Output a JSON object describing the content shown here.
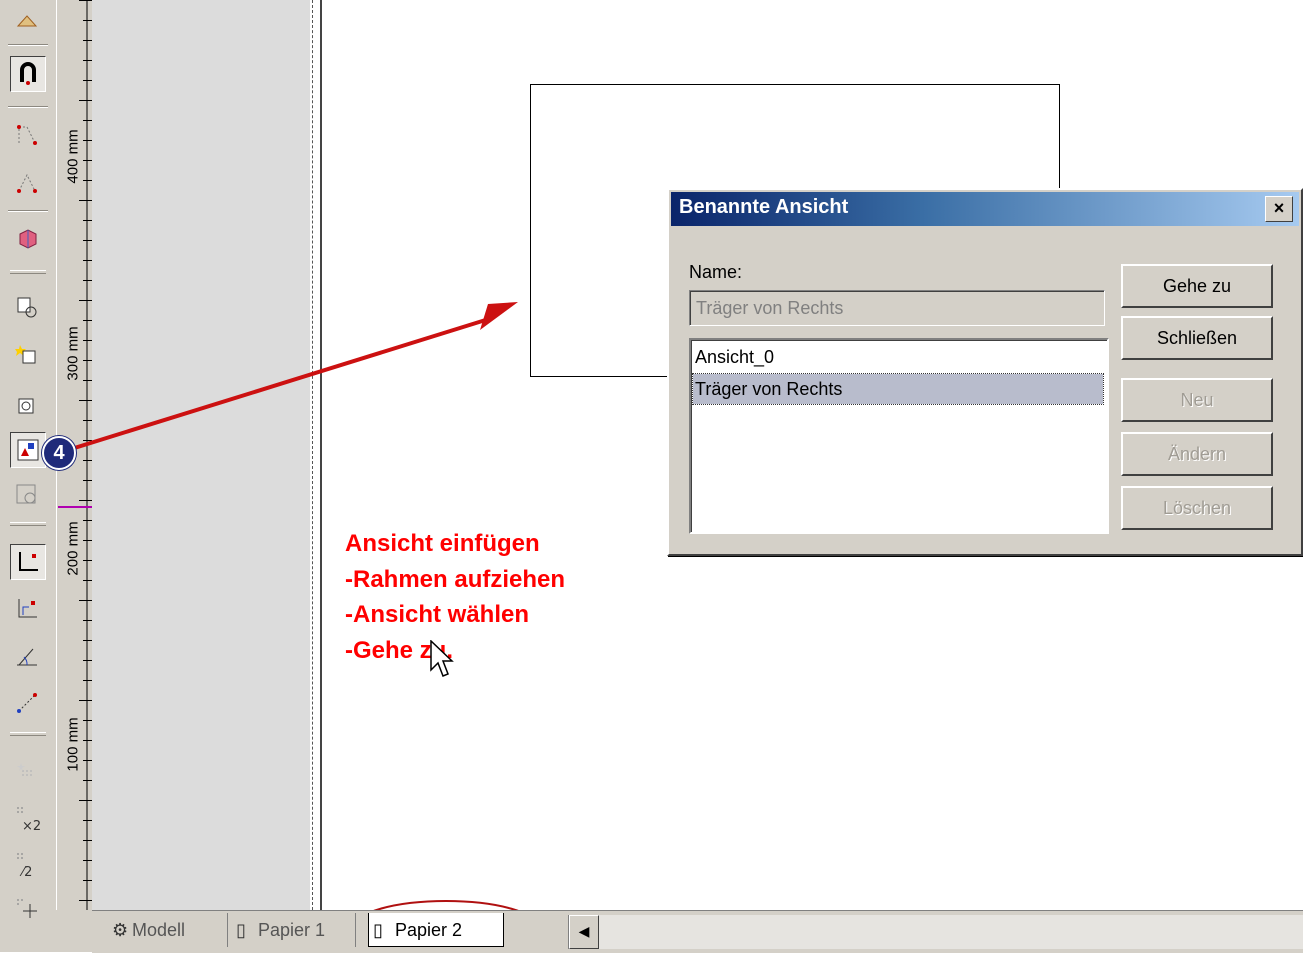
{
  "toolbar": {
    "items": [
      {
        "icon": "snap-magnet-icon",
        "pressed": true
      },
      {
        "icon": "polyline-points-icon"
      },
      {
        "icon": "angle-points-icon"
      },
      {
        "icon": "3d-box-icon"
      },
      {
        "icon": "insert-view-list-icon"
      },
      {
        "icon": "insert-view-star-icon"
      },
      {
        "icon": "insert-view-cam-icon"
      },
      {
        "icon": "insert-named-view-icon",
        "highlighted": true
      },
      {
        "icon": "view-disabled-icon"
      },
      {
        "icon": "dimension-corner-icon",
        "pressed": true
      },
      {
        "icon": "dimension-chain-icon"
      },
      {
        "icon": "angle-dimension-icon"
      },
      {
        "icon": "diagonal-dimension-icon"
      },
      {
        "icon": "grid-star-icon"
      },
      {
        "icon": "grid-x2-icon"
      },
      {
        "icon": "grid-half-icon"
      },
      {
        "icon": "grid-move-icon"
      }
    ],
    "badge": "4"
  },
  "ruler": {
    "labels": [
      "400 mm",
      "300 mm",
      "200 mm",
      "100 mm"
    ]
  },
  "instructions": [
    "Ansicht einfügen",
    "-Rahmen aufziehen",
    "-Ansicht wählen",
    "-Gehe zu."
  ],
  "dialog": {
    "title": "Benannte Ansicht",
    "close": "×",
    "name_label": "Name:",
    "name_value": "Träger von Rechts",
    "list_items": [
      "Ansicht_0",
      "Träger von Rechts"
    ],
    "selected_index": 1,
    "buttons": {
      "goto": "Gehe zu",
      "close": "Schließen",
      "new": "Neu",
      "edit": "Ändern",
      "delete": "Löschen"
    }
  },
  "tabs": [
    "Modell",
    "Papier 1",
    "Papier 2"
  ],
  "active_tab": "Papier 2",
  "colors": {
    "annotation_red": "#ff0000",
    "title_start": "#0a246a",
    "title_end": "#a6caf0",
    "badge": "#1f2a7a"
  }
}
